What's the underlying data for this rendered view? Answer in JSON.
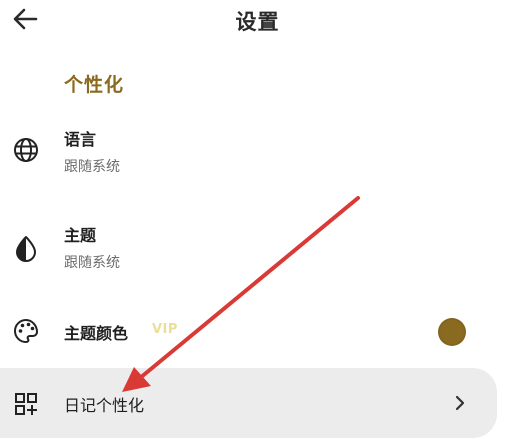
{
  "header": {
    "back_icon": "arrow-left-icon",
    "title": "设置"
  },
  "section": {
    "title": "个性化"
  },
  "rows": {
    "language": {
      "icon": "globe-icon",
      "label": "语言",
      "sublabel": "跟随系统"
    },
    "theme": {
      "icon": "contrast-icon",
      "label": "主题",
      "sublabel": "跟随系统"
    },
    "theme_color": {
      "icon": "palette-icon",
      "label": "主题颜色",
      "badge": "VIP",
      "selected_color": "#8a6a20"
    },
    "diary": {
      "icon": "widgets-grid-plus-icon",
      "label": "日记个性化",
      "chevron_icon": "chevron-right-icon"
    }
  },
  "colors": {
    "accent": "#8a6a20",
    "vip": "#e8df9a",
    "highlight_row_bg": "#ececec",
    "annotation_arrow": "#d93a36"
  }
}
